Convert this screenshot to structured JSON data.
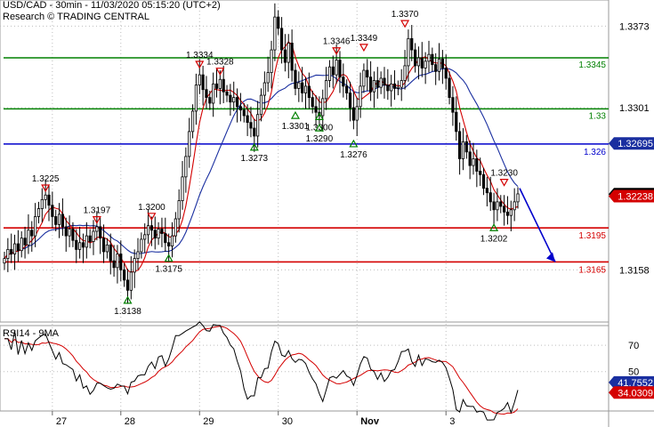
{
  "header": {
    "title": "USD/CAD - 30min - 11/03/2020 05:15:20 (UTC+2)",
    "subtitle": "Research © TRADING CENTRAL"
  },
  "colors": {
    "support": "#d40000",
    "resistance": "#008000",
    "pivot": "#0000cc",
    "ma_fast": "#d40000",
    "ma_slow": "#1a2fa0",
    "candle": "#000000",
    "grid": "#bdbdbd"
  },
  "chart_data": [
    {
      "type": "line",
      "name": "price",
      "y_axis_ticks": [
        "1.3373",
        "1.3301",
        "1.3158"
      ],
      "ylim": [
        1.3112,
        1.3396
      ],
      "x_ticks": [
        "27",
        "28",
        "29",
        "30",
        "Nov",
        "3"
      ],
      "horizontal_levels": [
        {
          "value": 1.3345,
          "label": "1.3345",
          "kind": "resistance"
        },
        {
          "value": 1.33,
          "label": "1.33",
          "kind": "resistance"
        },
        {
          "value": 1.3269,
          "label": "1.326",
          "kind": "pivot"
        },
        {
          "value": 1.3195,
          "label": "1.3195",
          "kind": "support"
        },
        {
          "value": 1.3165,
          "label": "1.3165",
          "kind": "support"
        }
      ],
      "price_tags": [
        {
          "value": 1.32695,
          "label": "1.32695",
          "style": "pivot"
        },
        {
          "value": 1.32248,
          "label": "1.32248",
          "style": "last"
        },
        {
          "value": 1.3223,
          "label": "1.32238",
          "style": "fast"
        }
      ],
      "swing_labels": [
        {
          "label": "1.3225",
          "value": 1.3225,
          "idx": 12,
          "kind": "high"
        },
        {
          "label": "1.3197",
          "value": 1.3197,
          "idx": 27,
          "kind": "high"
        },
        {
          "label": "1.3138",
          "value": 1.3138,
          "idx": 36,
          "kind": "low"
        },
        {
          "label": "1.3200",
          "value": 1.32,
          "idx": 43,
          "kind": "high"
        },
        {
          "label": "1.3175",
          "value": 1.3175,
          "idx": 48,
          "kind": "low"
        },
        {
          "label": "1.3334",
          "value": 1.3334,
          "idx": 57,
          "kind": "high"
        },
        {
          "label": "1.3328",
          "value": 1.3328,
          "idx": 63,
          "kind": "high"
        },
        {
          "label": "1.3273",
          "value": 1.3273,
          "idx": 73,
          "kind": "low"
        },
        {
          "label": "1.3396",
          "value": 1.3396,
          "idx": 79,
          "kind": "high"
        },
        {
          "label": "1.3301",
          "value": 1.3301,
          "idx": 85,
          "kind": "low"
        },
        {
          "label": "1.3300",
          "value": 1.33,
          "idx": 92,
          "kind": "low"
        },
        {
          "label": "1.3346",
          "value": 1.3346,
          "idx": 97,
          "kind": "high"
        },
        {
          "label": "1.3290",
          "value": 1.329,
          "idx": 92,
          "kind": "low"
        },
        {
          "label": "1.3276",
          "value": 1.3276,
          "idx": 102,
          "kind": "low"
        },
        {
          "label": "1.3349",
          "value": 1.3349,
          "idx": 105,
          "kind": "high"
        },
        {
          "label": "1.3370",
          "value": 1.337,
          "idx": 117,
          "kind": "high"
        },
        {
          "label": "1.3230",
          "value": 1.323,
          "idx": 146,
          "kind": "high"
        },
        {
          "label": "1.3202",
          "value": 1.3202,
          "idx": 143,
          "kind": "low"
        }
      ],
      "forecast": {
        "from": 1.323,
        "to": 1.3165
      },
      "close": [
        1.3168,
        1.3176,
        1.3172,
        1.3181,
        1.3175,
        1.3186,
        1.318,
        1.3193,
        1.3188,
        1.3205,
        1.3212,
        1.322,
        1.3224,
        1.3215,
        1.3205,
        1.3198,
        1.3207,
        1.3196,
        1.3188,
        1.3194,
        1.3184,
        1.3176,
        1.3182,
        1.3178,
        1.3188,
        1.3183,
        1.3192,
        1.3196,
        1.3186,
        1.3174,
        1.318,
        1.3166,
        1.316,
        1.3172,
        1.3158,
        1.3149,
        1.314,
        1.3156,
        1.3168,
        1.3174,
        1.3185,
        1.3189,
        1.3197,
        1.3193,
        1.3186,
        1.3194,
        1.319,
        1.3182,
        1.3179,
        1.3188,
        1.3203,
        1.3219,
        1.324,
        1.3258,
        1.328,
        1.3298,
        1.3321,
        1.333,
        1.3317,
        1.331,
        1.3305,
        1.3322,
        1.3318,
        1.3326,
        1.3315,
        1.3312,
        1.3306,
        1.331,
        1.3302,
        1.3299,
        1.3294,
        1.3288,
        1.3283,
        1.3276,
        1.3295,
        1.3312,
        1.3323,
        1.3332,
        1.3352,
        1.3381,
        1.3371,
        1.3352,
        1.3341,
        1.3358,
        1.3334,
        1.3318,
        1.3323,
        1.3314,
        1.332,
        1.331,
        1.3302,
        1.3297,
        1.3294,
        1.3309,
        1.3325,
        1.3337,
        1.333,
        1.3343,
        1.3328,
        1.332,
        1.3314,
        1.3301,
        1.329,
        1.3302,
        1.332,
        1.3334,
        1.3328,
        1.3315,
        1.3325,
        1.3319,
        1.3327,
        1.3321,
        1.3316,
        1.3322,
        1.3318,
        1.3319,
        1.3325,
        1.3338,
        1.3362,
        1.3352,
        1.3338,
        1.3345,
        1.3336,
        1.3342,
        1.3348,
        1.3339,
        1.3333,
        1.3344,
        1.3336,
        1.3327,
        1.331,
        1.3297,
        1.328,
        1.3256,
        1.3271,
        1.3262,
        1.325,
        1.3256,
        1.3245,
        1.3242,
        1.323,
        1.3226,
        1.3218,
        1.3211,
        1.3218,
        1.3214,
        1.3209,
        1.3206,
        1.3211,
        1.3218,
        1.3225
      ]
    },
    {
      "type": "line",
      "name": "RSI14 - 9MA",
      "y_axis_ticks": [
        "70",
        "50"
      ],
      "ylim": [
        20,
        85
      ],
      "price_tags": [
        {
          "value": 41.7552,
          "label": "41.7552",
          "style": "rsi"
        },
        {
          "value": 34.0309,
          "label": "34.0309",
          "style": "rsima"
        }
      ]
    }
  ]
}
